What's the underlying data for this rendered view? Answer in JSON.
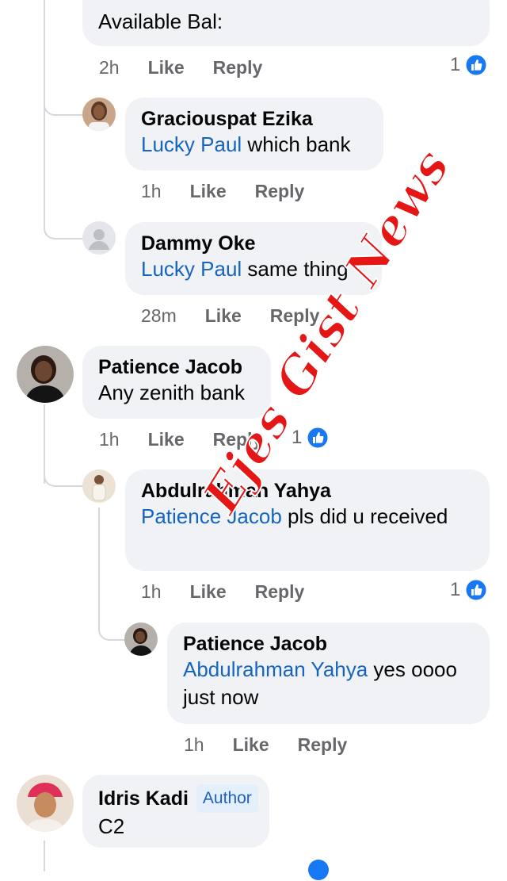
{
  "comments": [
    {
      "id": "c0",
      "text": "Available Bal:",
      "time": "2h",
      "like": "Like",
      "reply": "Reply",
      "likes": "1"
    },
    {
      "id": "c1",
      "name": "Graciouspat Ezika",
      "mention": "Lucky Paul",
      "text": " which bank",
      "time": "1h",
      "like": "Like",
      "reply": "Reply"
    },
    {
      "id": "c2",
      "name": "Dammy Oke",
      "mention": "Lucky Paul",
      "text": " same thing",
      "time": "28m",
      "like": "Like",
      "reply": "Reply"
    },
    {
      "id": "c3",
      "name": "Patience Jacob",
      "text": "Any zenith bank",
      "time": "1h",
      "like": "Like",
      "reply": "Reply",
      "likes": "1"
    },
    {
      "id": "c4",
      "name": "Abdulrahman Yahya",
      "mention": "Patience Jacob",
      "text": " pls did u received",
      "time": "1h",
      "like": "Like",
      "reply": "Reply",
      "likes": "1"
    },
    {
      "id": "c5",
      "name": "Patience Jacob",
      "mention": "Abdulrahman Yahya",
      "text": " yes oooo just now",
      "time": "1h",
      "like": "Like",
      "reply": "Reply"
    },
    {
      "id": "c6",
      "name": "Idris Kadi",
      "badge": "Author",
      "text": "C2"
    }
  ],
  "watermark": "Ejes Gist News",
  "colors": {
    "like_blue": "#1877f2",
    "mention": "#1565c0",
    "bubble": "#f0f2f5",
    "watermark": "#e51616"
  },
  "icons": [
    "like-thumb-icon",
    "default-avatar-icon"
  ]
}
